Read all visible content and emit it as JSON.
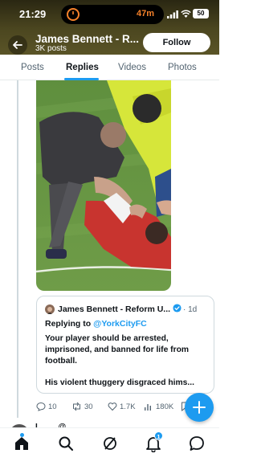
{
  "status_bar": {
    "time": "21:29",
    "timer": "47m",
    "battery": "50"
  },
  "header": {
    "profile_name": "James Bennett - R...",
    "posts_count": "3K posts",
    "follow_label": "Follow"
  },
  "tabs": [
    {
      "label": "Posts",
      "active": false
    },
    {
      "label": "Replies",
      "active": true
    },
    {
      "label": "Videos",
      "active": false
    },
    {
      "label": "Photos",
      "active": false
    }
  ],
  "quoted_tweet": {
    "author": "James Bennett - Reform U...",
    "verified": true,
    "time": "· 1d",
    "replying_to_label": "Replying to ",
    "replying_to_handle": "@YorkCityFC",
    "body_1": "Your player should be arrested, imprisoned, and banned for life from football.",
    "body_2": "His violent thuggery disgraced hims..."
  },
  "actions": {
    "replies": "10",
    "reposts": "30",
    "likes": "1.7K",
    "views": "180K"
  },
  "next_tweet_preview": "L... ... @...",
  "bottom_nav": {
    "notifications_badge": "1"
  },
  "colors": {
    "accent": "#1d9bf0",
    "banner": "#4c4720",
    "timer": "#f5812a"
  }
}
